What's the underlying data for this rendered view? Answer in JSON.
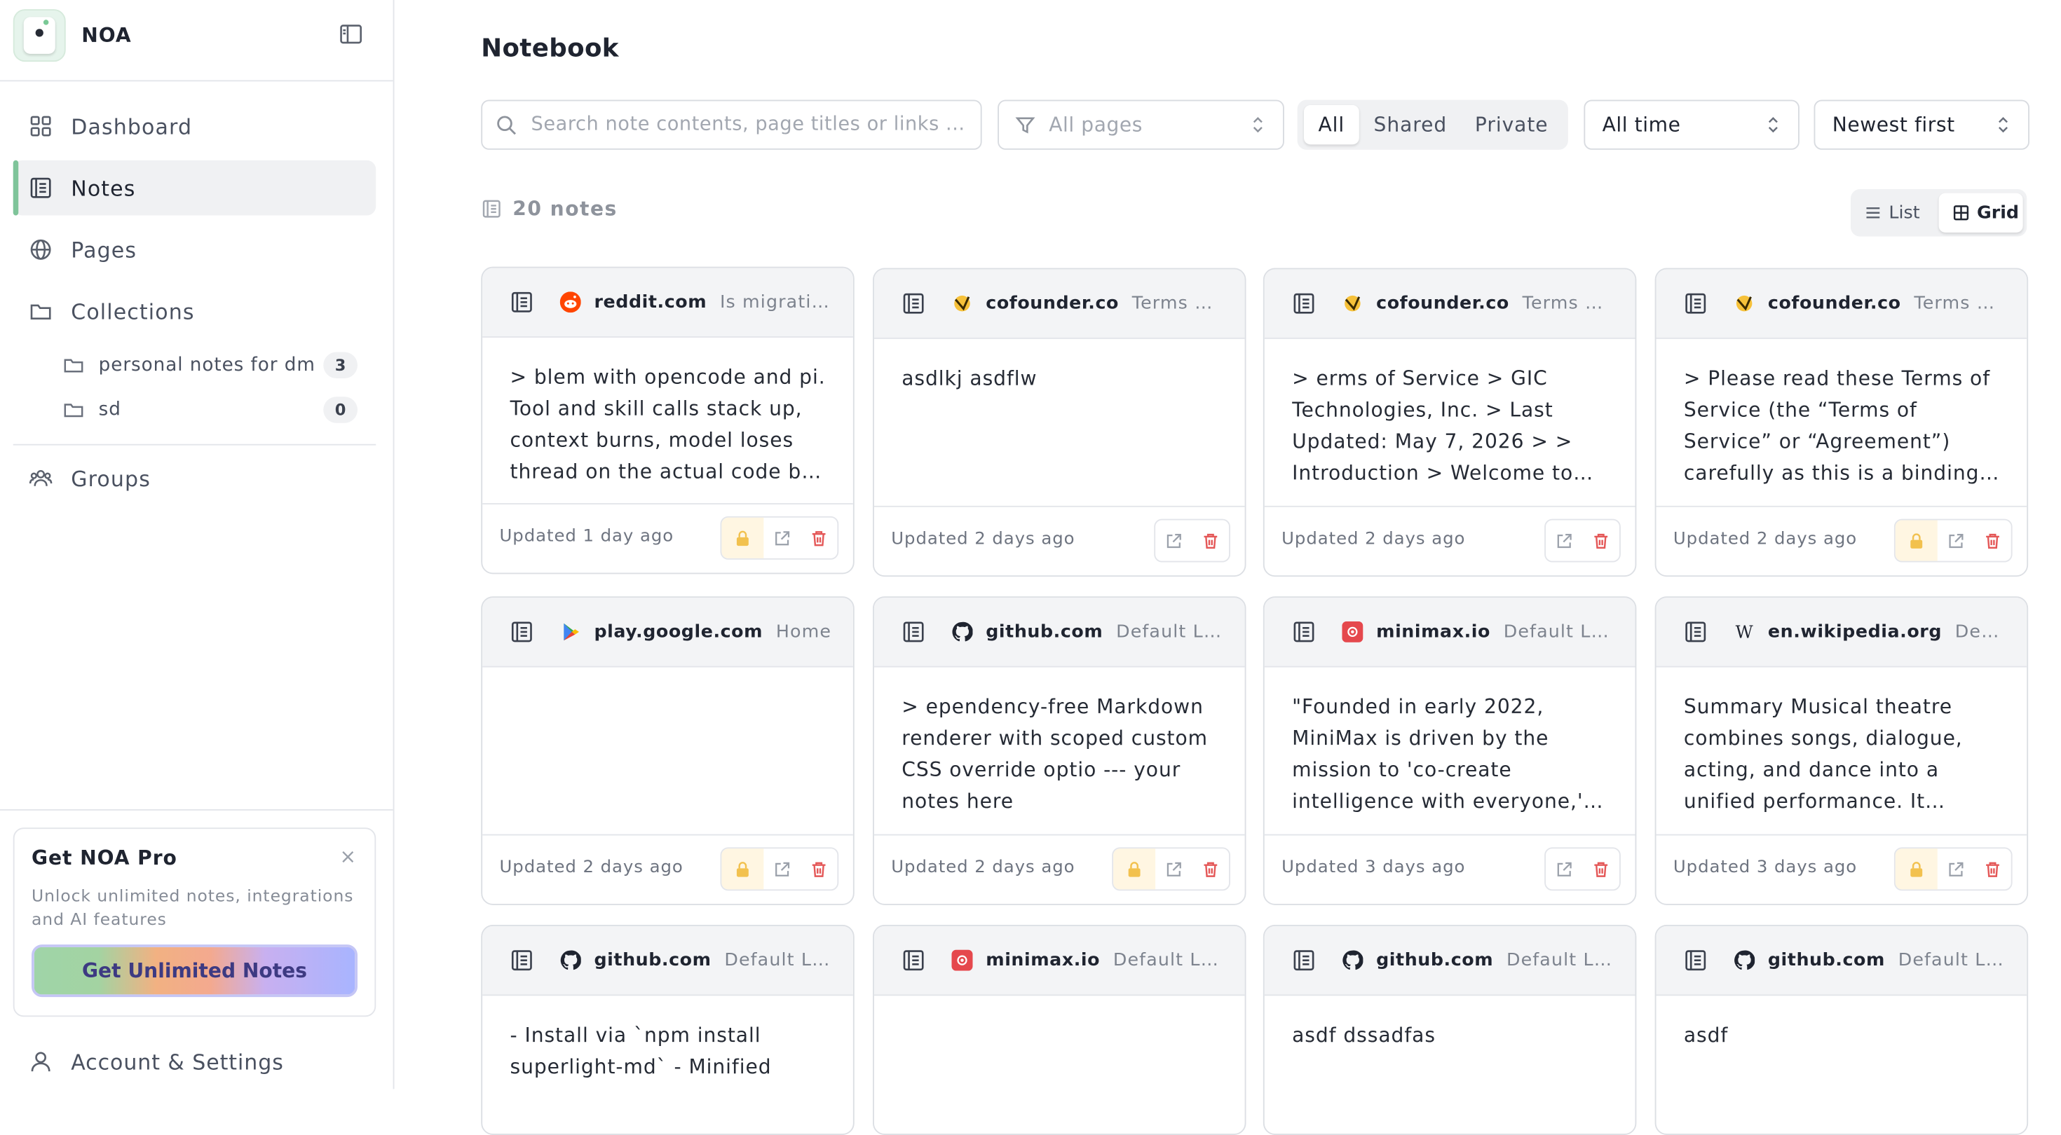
{
  "app": {
    "name": "NOA"
  },
  "sidebar": {
    "nav": [
      {
        "label": "Dashboard",
        "icon": "dashboard-icon"
      },
      {
        "label": "Notes",
        "icon": "notes-icon",
        "active": true
      },
      {
        "label": "Pages",
        "icon": "globe-icon"
      },
      {
        "label": "Collections",
        "icon": "folder-icon"
      }
    ],
    "collections": [
      {
        "label": "personal notes for dm",
        "count": "3"
      },
      {
        "label": "sd",
        "count": "0"
      }
    ],
    "groups_label": "Groups",
    "promo": {
      "title": "Get NOA Pro",
      "close": "×",
      "description": "Unlock unlimited notes, integrations and AI features",
      "button": "Get Unlimited Notes"
    },
    "account_label": "Account & Settings"
  },
  "main": {
    "title": "Notebook",
    "search": {
      "placeholder": "Search note contents, page titles or links ..."
    },
    "page_filter": {
      "placeholder": "All pages"
    },
    "visibility": {
      "options": [
        "All",
        "Shared",
        "Private"
      ],
      "selected": "All"
    },
    "time_filter": {
      "value": "All time"
    },
    "sort": {
      "value": "Newest first"
    },
    "count_label": "20 notes",
    "view_toggle": {
      "list": "List",
      "grid": "Grid",
      "selected": "Grid"
    },
    "notes": [
      {
        "site": "reddit.com",
        "favicon": "reddit-icon",
        "page": "Is migrating ...",
        "body": "> blem with opencode and pi. Tool and skill calls stack up, context burns, model loses thread on the actual code by the time you get to it",
        "updated": "Updated 1 day ago",
        "locked": true
      },
      {
        "site": "cofounder.co",
        "favicon": "cofounder-icon",
        "page": "Terms of S...",
        "body": "asdlkj asdflw",
        "updated": "Updated 2 days ago",
        "locked": false
      },
      {
        "site": "cofounder.co",
        "favicon": "cofounder-icon",
        "page": "Terms of S...",
        "body": "> erms of Service > GIC Technologies, Inc. > Last Updated: May 7, 2026 > > Introduction > Welcome to Cofounder",
        "updated": "Updated 2 days ago",
        "locked": false
      },
      {
        "site": "cofounder.co",
        "favicon": "cofounder-icon",
        "page": "Terms of S...",
        "body": "> Please read these Terms of Service (the “Terms of Service” or “Agreement”) carefully as this is a binding contract",
        "updated": "Updated 2 days ago",
        "locked": true
      },
      {
        "site": "play.google.com",
        "favicon": "google-play-icon",
        "page": "Home",
        "body": "",
        "updated": "Updated 2 days ago",
        "locked": true
      },
      {
        "site": "github.com",
        "favicon": "github-icon",
        "page": "Default Layer",
        "body": "> ependency-free Markdown renderer with scoped custom CSS override optio --- your notes here",
        "updated": "Updated 2 days ago",
        "locked": true
      },
      {
        "site": "minimax.io",
        "favicon": "minimax-icon",
        "page": "Default Layer",
        "body": "\"Founded in early 2022, MiniMax is driven by the mission to 'co-create intelligence with everyone,' and is a leading",
        "updated": "Updated 3 days ago",
        "locked": false
      },
      {
        "site": "en.wikipedia.org",
        "favicon": "wikipedia-icon",
        "page": "Default...",
        "body": "Summary Musical theatre combines songs, dialogue, acting, and dance into a unified performance. It emerged",
        "updated": "Updated 3 days ago",
        "locked": true
      },
      {
        "site": "github.com",
        "favicon": "github-icon",
        "page": "Default Layer",
        "body": "- Install via `npm install superlight-md` - Minified",
        "updated": "",
        "locked": false
      },
      {
        "site": "minimax.io",
        "favicon": "minimax-icon",
        "page": "Default Layer",
        "body": "",
        "updated": "",
        "locked": false
      },
      {
        "site": "github.com",
        "favicon": "github-icon",
        "page": "Default Layer",
        "body": "asdf dssadfas",
        "updated": "",
        "locked": false
      },
      {
        "site": "github.com",
        "favicon": "github-icon",
        "page": "Default Layer",
        "body": "asdf",
        "updated": "",
        "locked": false
      }
    ]
  },
  "colors": {
    "accent": "#7fc49a",
    "danger": "#e45858",
    "lock_bg": "#fff6e2"
  }
}
